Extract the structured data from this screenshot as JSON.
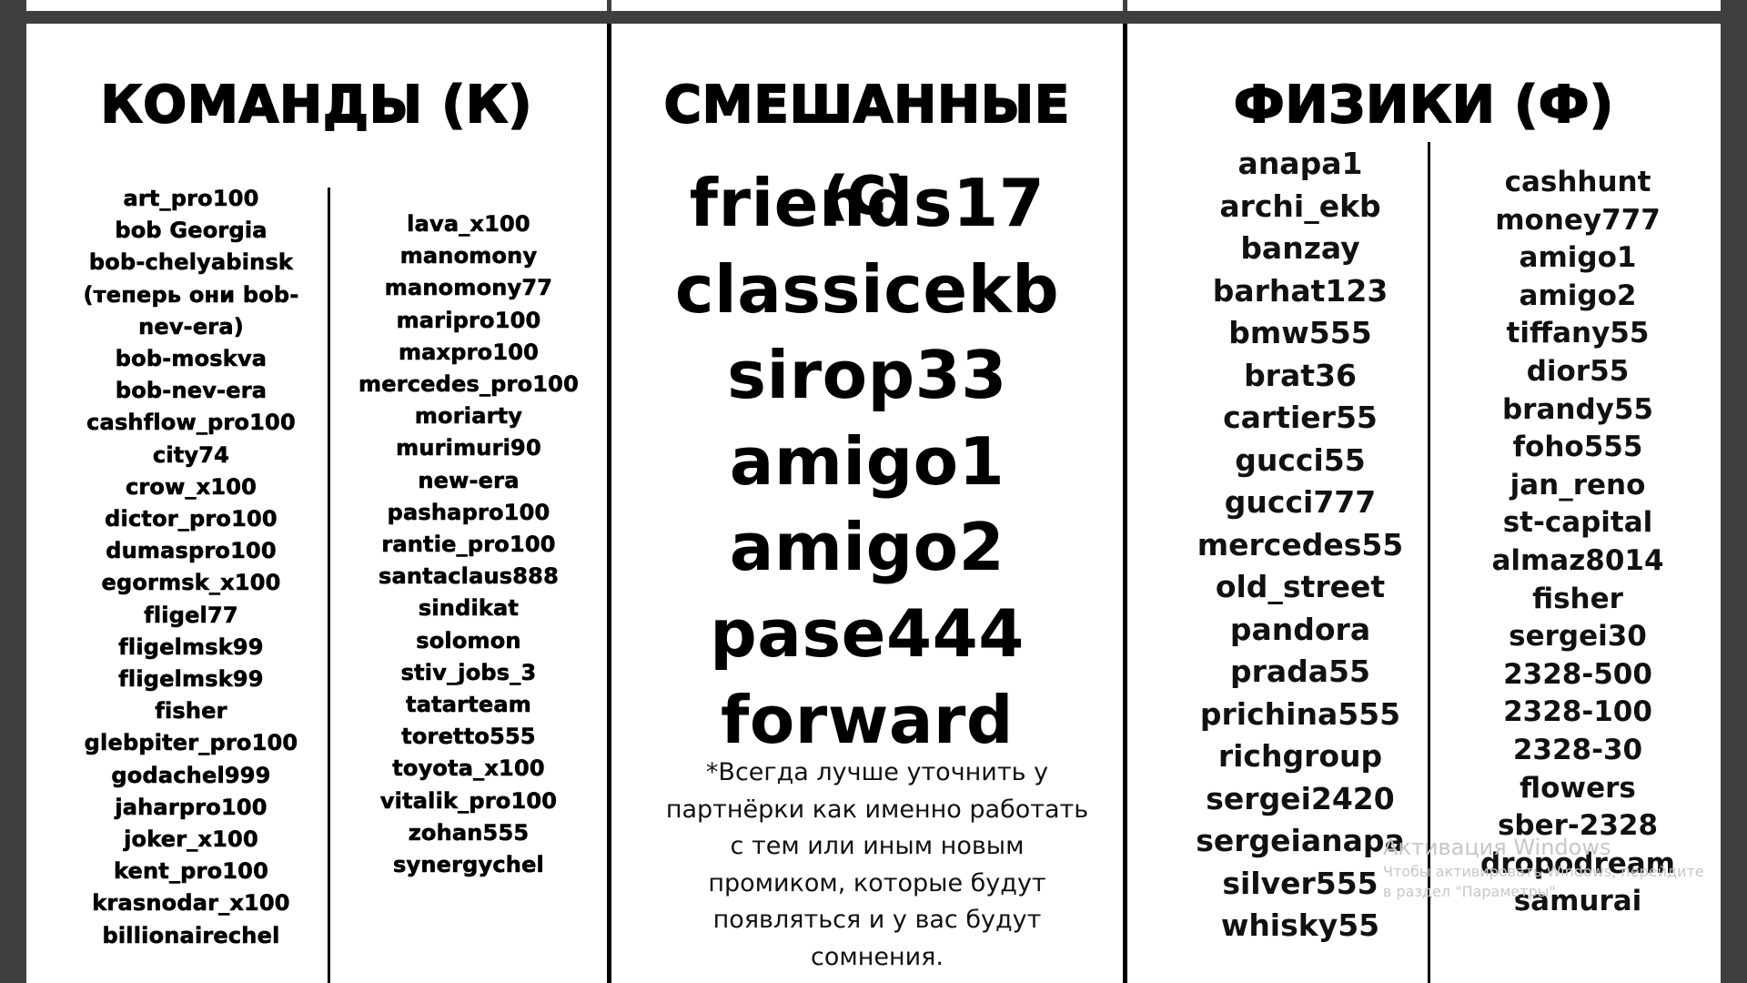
{
  "sections": {
    "commands": {
      "title": "КОМАНДЫ (К)",
      "left": [
        "art_pro100",
        "bob Georgia",
        "bob-chelyabinsk",
        "(теперь они bob-",
        "nev-era)",
        "bob-moskva",
        "bob-nev-era",
        "cashflow_pro100",
        "city74",
        "crow_x100",
        "dictor_pro100",
        "dumaspro100",
        "egormsk_x100",
        "fligel77",
        "fligelmsk99",
        "fligelmsk99",
        "fisher",
        "glebpiter_pro100",
        "godachel999",
        "jaharpro100",
        "joker_x100",
        "kent_pro100",
        "krasnodar_x100",
        "billionairechel"
      ],
      "right": [
        "lava_x100",
        "manomony",
        "manomony77",
        "maripro100",
        "maxpro100",
        "mercedes_pro100",
        "moriarty",
        "murimuri90",
        "new-era",
        "pashapro100",
        "rantie_pro100",
        "santaclaus888",
        "sindikat",
        "solomon",
        "stiv_jobs_3",
        "tatarteam",
        "toretto555",
        "toyota_x100",
        "vitalik_pro100",
        "zohan555",
        "synergychel"
      ]
    },
    "mixed": {
      "title": "СМЕШАННЫЕ (С)",
      "items": [
        "friends17",
        "classicekb",
        "sirop33",
        "amigo1",
        "amigo2",
        "pase444",
        "forward"
      ],
      "note": "*Всегда лучше уточнить у партнёрки как именно работать с тем или иным новым промиком, которые будут появляться и у вас будут сомнения."
    },
    "physics": {
      "title": "ФИЗИКИ (Ф)",
      "left": [
        "anapa1",
        "archi_ekb",
        "banzay",
        "barhat123",
        "bmw555",
        "brat36",
        "cartier55",
        "gucci55",
        "gucci777",
        "mercedes55",
        "old_street",
        "pandora",
        "prada55",
        "prichina555",
        "richgroup",
        "sergei2420",
        "sergeianapa",
        "silver555",
        "whisky55"
      ],
      "right": [
        "cashhunt",
        "money777",
        "amigo1",
        "amigo2",
        "tiffany55",
        "dior55",
        "brandy55",
        "foho555",
        "jan_reno",
        "st-capital",
        "almaz8014",
        "fisher",
        "sergei30",
        "2328-500",
        "2328-100",
        "2328-30",
        "flowers",
        "sber-2328",
        "dropodream",
        "samurai"
      ]
    }
  },
  "watermark": {
    "title": "Активация Windows",
    "subtitle": "Чтобы активировать Windows, перейдите в раздел \"Параметры\"."
  }
}
